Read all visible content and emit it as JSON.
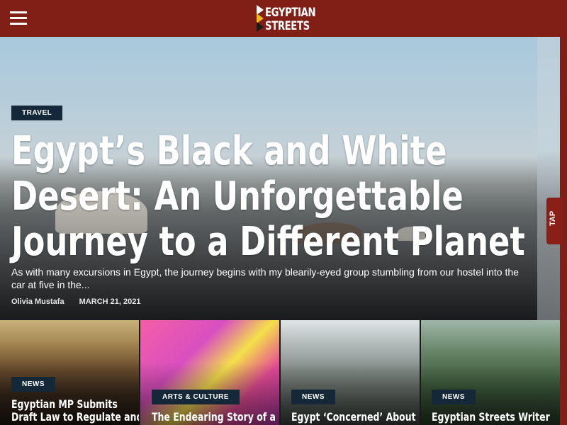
{
  "header": {
    "menu_icon": "hamburger-icon",
    "logo_line1": "EGYPTIAN",
    "logo_line2": "STREETS",
    "bg_color": "#7f1f16"
  },
  "hero": {
    "category": "TRAVEL",
    "title": "Egypt’s Black and White Desert: An Unforgettable Journey to a Different Planet",
    "excerpt": "As with many excursions in Egypt, the journey begins with my blearily-eyed group stumbling from our hostel into the car at five in the...",
    "author": "Olivia Mustafa",
    "date": "MARCH 21, 2021"
  },
  "tap_tab": {
    "label": "TAP"
  },
  "cards": [
    {
      "category": "NEWS",
      "title_line1": "Egyptian MP Submits",
      "title_line2": "Draft Law to Regulate and"
    },
    {
      "category": "ARTS & CULTURE",
      "title_line1": "The Endearing Story of a",
      "title_line2": ""
    },
    {
      "category": "NEWS",
      "title_line1": "Egypt ‘Concerned’ About",
      "title_line2": ""
    },
    {
      "category": "NEWS",
      "title_line1": "Egyptian Streets Writer",
      "title_line2": ""
    }
  ],
  "colors": {
    "brand_red": "#7f1f16",
    "badge_navy": "#14283a"
  }
}
